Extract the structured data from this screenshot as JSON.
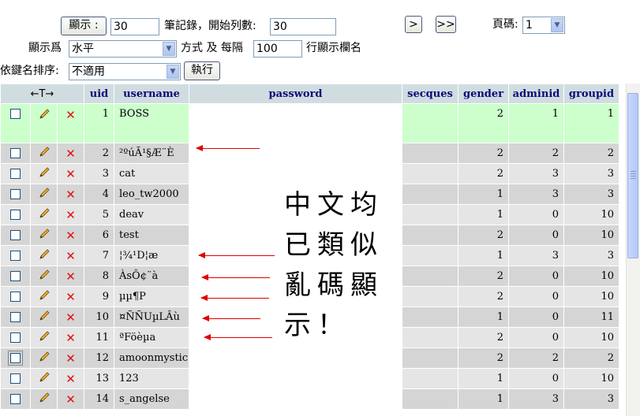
{
  "controls": {
    "show_button": "顯示 :",
    "rows_value": "30",
    "records_label": "筆記錄，開始列數:",
    "start_value": "30",
    "next_button": ">",
    "last_button": ">>",
    "page_label": "頁碼:",
    "page_value": "1",
    "display_as_label": "顯示爲",
    "mode_value": "水平",
    "mode_suffix": "方式 及 每隔",
    "repeat_value": "100",
    "repeat_suffix": "行顯示欄名",
    "sort_label": "依鍵名排序:",
    "sort_value": "不適用",
    "execute_button": "執行"
  },
  "table": {
    "nav_arrows": "←T→",
    "columns": [
      "uid",
      "username",
      "password",
      "secques",
      "gender",
      "adminid",
      "groupid"
    ],
    "rows": [
      {
        "uid": "1",
        "username": "BOSS",
        "gender": "2",
        "adminid": "1",
        "groupid": "1"
      },
      {
        "uid": "2",
        "username": "²ºúÃ¹§Æ¨È",
        "gender": "2",
        "adminid": "2",
        "groupid": "2"
      },
      {
        "uid": "3",
        "username": "cat",
        "gender": "2",
        "adminid": "3",
        "groupid": "3"
      },
      {
        "uid": "4",
        "username": "leo_tw2000",
        "gender": "1",
        "adminid": "3",
        "groupid": "3"
      },
      {
        "uid": "5",
        "username": "deav",
        "gender": "1",
        "adminid": "0",
        "groupid": "10"
      },
      {
        "uid": "6",
        "username": "test",
        "gender": "2",
        "adminid": "0",
        "groupid": "10"
      },
      {
        "uid": "7",
        "username": "¦¾¹D¦æ",
        "gender": "1",
        "adminid": "3",
        "groupid": "3"
      },
      {
        "uid": "8",
        "username": "ÀsÔ¢¨à",
        "gender": "2",
        "adminid": "0",
        "groupid": "10"
      },
      {
        "uid": "9",
        "username": "µµ¶P",
        "gender": "2",
        "adminid": "0",
        "groupid": "10"
      },
      {
        "uid": "10",
        "username": "¤ÑÑUµLÂù",
        "gender": "1",
        "adminid": "0",
        "groupid": "11"
      },
      {
        "uid": "11",
        "username": "ªFöèµa",
        "gender": "2",
        "adminid": "0",
        "groupid": "10"
      },
      {
        "uid": "12",
        "username": "amoonmystic",
        "gender": "2",
        "adminid": "2",
        "groupid": "2"
      },
      {
        "uid": "13",
        "username": "123",
        "gender": "1",
        "adminid": "0",
        "groupid": "10"
      },
      {
        "uid": "14",
        "username": "s_angelse",
        "gender": "1",
        "adminid": "3",
        "groupid": "3"
      }
    ]
  },
  "annotation": {
    "lines": [
      "中文均",
      "已類似",
      "亂碼顯",
      "示！"
    ],
    "arrow_color": "#e00000"
  },
  "icons": {
    "edit": "pencil-icon",
    "delete": "delete-x-icon"
  }
}
